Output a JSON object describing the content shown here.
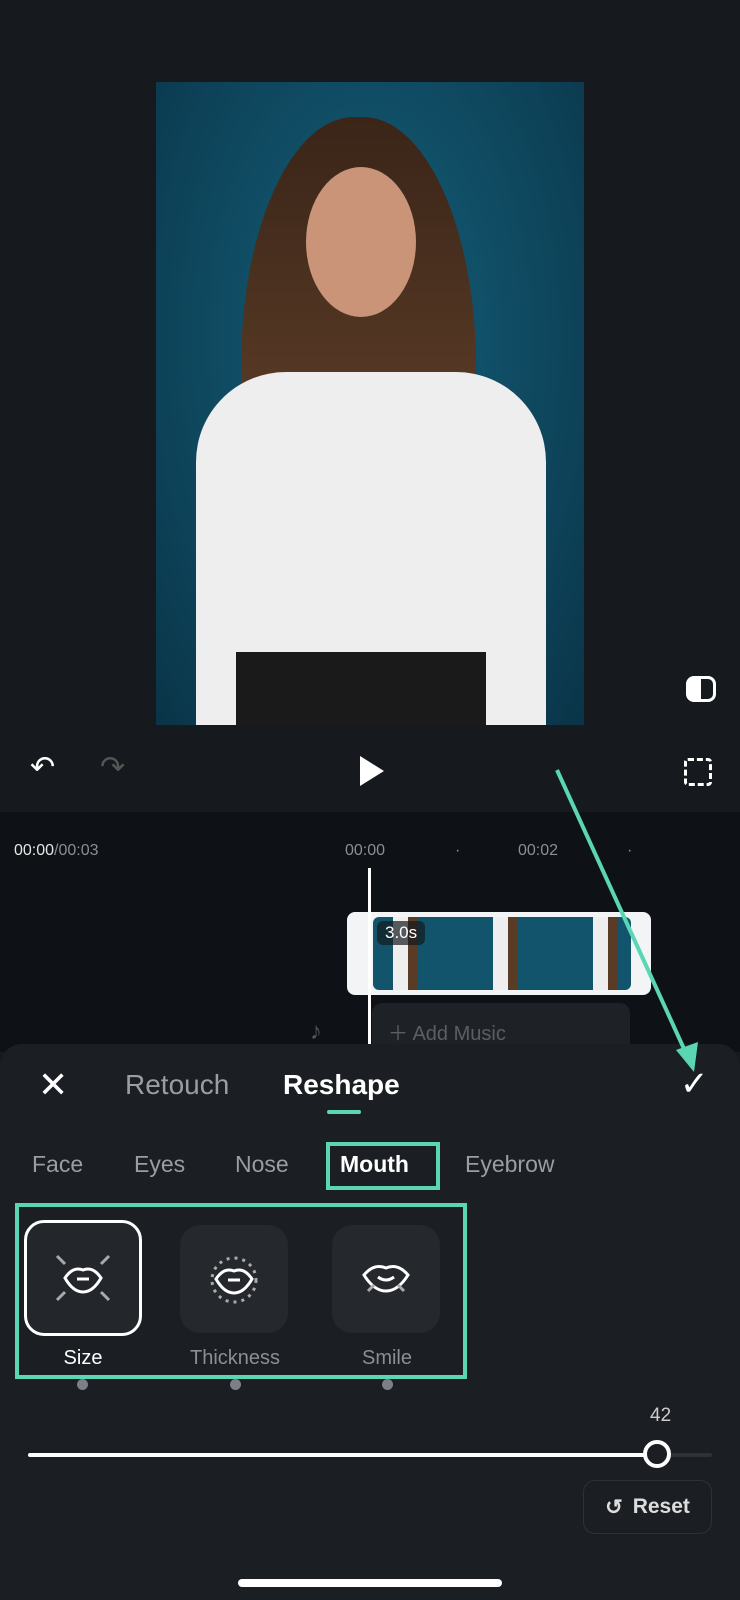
{
  "player": {
    "current_time": "00:00",
    "total_time": "/00:03"
  },
  "timeline": {
    "ruler": [
      "00:00",
      "00:02"
    ],
    "clip_duration": "3.0s",
    "add_music": "Add Music"
  },
  "panel": {
    "tabs": [
      {
        "label": "Retouch",
        "active": false
      },
      {
        "label": "Reshape",
        "active": true
      }
    ],
    "subtabs": [
      {
        "label": "Face"
      },
      {
        "label": "Eyes"
      },
      {
        "label": "Nose"
      },
      {
        "label": "Mouth",
        "active": true
      },
      {
        "label": "Eyebrow"
      }
    ],
    "tools": [
      {
        "label": "Size",
        "selected": true
      },
      {
        "label": "Thickness"
      },
      {
        "label": "Smile"
      }
    ],
    "slider": {
      "value_label": "42",
      "value": 42,
      "min": -50,
      "max": 50
    },
    "reset_label": "Reset"
  },
  "colors": {
    "annotation": "#5ad6b4"
  }
}
